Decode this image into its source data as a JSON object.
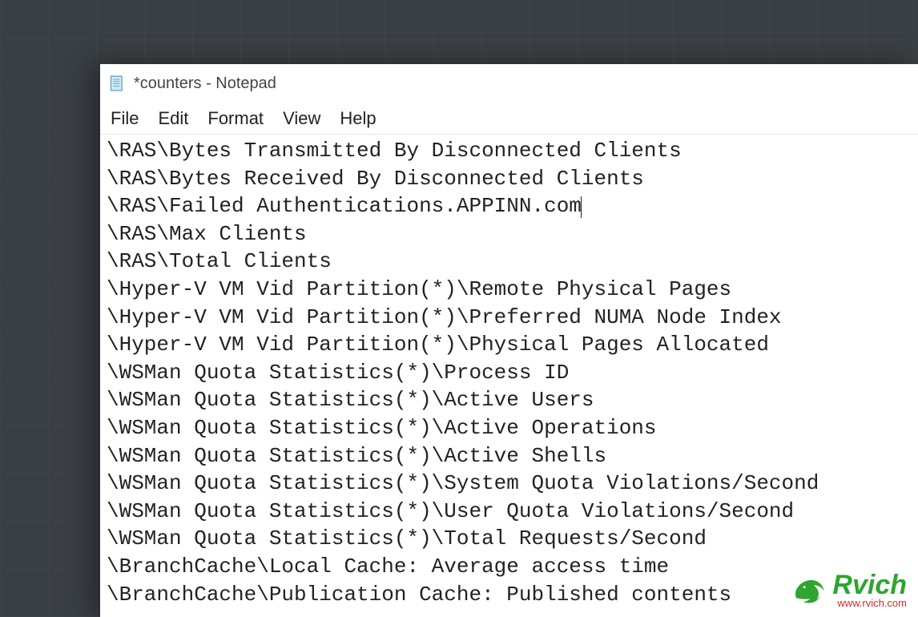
{
  "window": {
    "title": "*counters - Notepad"
  },
  "menu": {
    "items": [
      "File",
      "Edit",
      "Format",
      "View",
      "Help"
    ]
  },
  "editor": {
    "cursor_line_index": 2,
    "lines": [
      "\\RAS\\Bytes Transmitted By Disconnected Clients",
      "\\RAS\\Bytes Received By Disconnected Clients",
      "\\RAS\\Failed Authentications.APPINN.com",
      "\\RAS\\Max Clients",
      "\\RAS\\Total Clients",
      "\\Hyper-V VM Vid Partition(*)\\Remote Physical Pages",
      "\\Hyper-V VM Vid Partition(*)\\Preferred NUMA Node Index",
      "\\Hyper-V VM Vid Partition(*)\\Physical Pages Allocated",
      "\\WSMan Quota Statistics(*)\\Process ID",
      "\\WSMan Quota Statistics(*)\\Active Users",
      "\\WSMan Quota Statistics(*)\\Active Operations",
      "\\WSMan Quota Statistics(*)\\Active Shells",
      "\\WSMan Quota Statistics(*)\\System Quota Violations/Second",
      "\\WSMan Quota Statistics(*)\\User Quota Violations/Second",
      "\\WSMan Quota Statistics(*)\\Total Requests/Second",
      "\\BranchCache\\Local Cache: Average access time",
      "\\BranchCache\\Publication Cache: Published contents"
    ]
  },
  "watermark": {
    "brand": "Rvich",
    "url": "www.rvich.com"
  }
}
